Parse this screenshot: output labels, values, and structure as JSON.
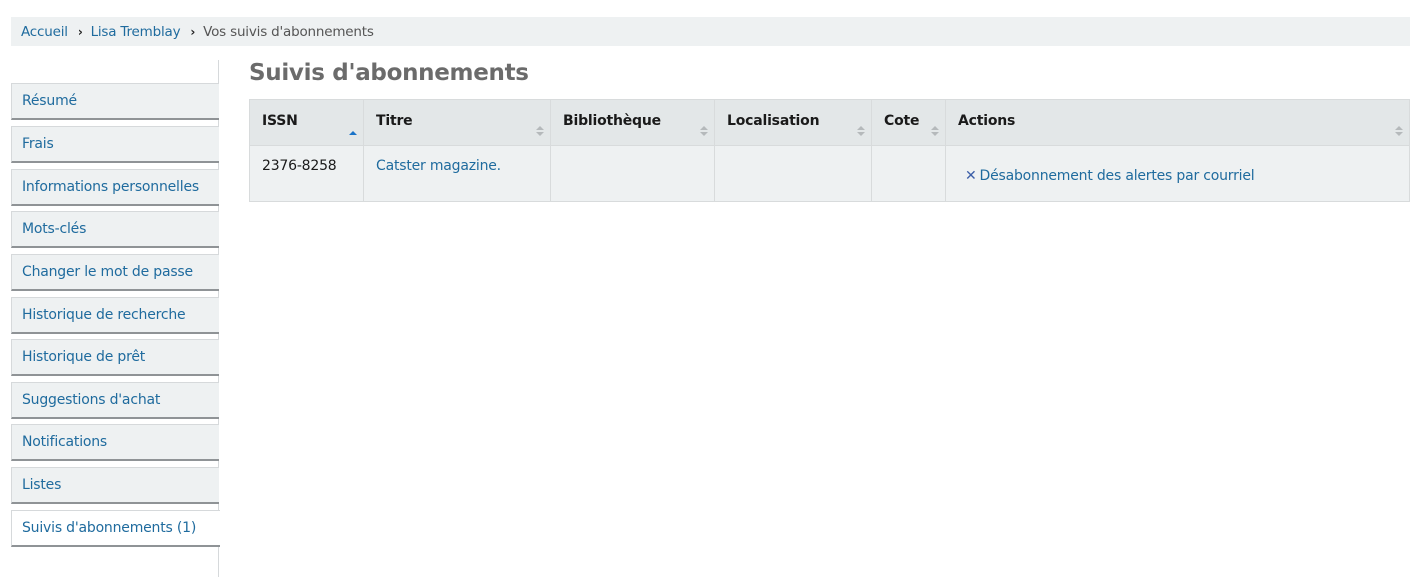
{
  "breadcrumb": {
    "items": [
      {
        "label": "Accueil",
        "link": true
      },
      {
        "label": "Lisa Tremblay",
        "link": true
      },
      {
        "label": "Vos suivis d'abonnements",
        "link": false
      }
    ],
    "separator_icon": "chevron-right-icon"
  },
  "sidebar": {
    "items": [
      {
        "label": "Résumé",
        "active": false
      },
      {
        "label": "Frais",
        "active": false
      },
      {
        "label": "Informations personnelles",
        "active": false
      },
      {
        "label": "Mots-clés",
        "active": false
      },
      {
        "label": "Changer le mot de passe",
        "active": false
      },
      {
        "label": "Historique de recherche",
        "active": false
      },
      {
        "label": "Historique de prêt",
        "active": false
      },
      {
        "label": "Suggestions d'achat",
        "active": false
      },
      {
        "label": "Notifications",
        "active": false
      },
      {
        "label": "Listes",
        "active": false
      },
      {
        "label": "Suivis d'abonnements (1)",
        "active": true
      }
    ]
  },
  "main": {
    "title": "Suivis d'abonnements",
    "table": {
      "columns": [
        {
          "label": "ISSN",
          "sort": "ascending"
        },
        {
          "label": "Titre",
          "sort": "none"
        },
        {
          "label": "Bibliothèque",
          "sort": "none"
        },
        {
          "label": "Localisation",
          "sort": "none"
        },
        {
          "label": "Cote",
          "sort": "none"
        },
        {
          "label": "Actions",
          "sort": "none"
        }
      ],
      "rows": [
        {
          "issn": "2376-8258",
          "title": "Catster magazine.",
          "library": "",
          "location": "",
          "callnumber": "",
          "action_label": "Désabonnement des alertes par courriel",
          "action_icon": "close-icon"
        }
      ]
    },
    "colors": {
      "link": "#1f6b9e",
      "sort_active": "#1a73c8",
      "sort_inactive": "#b5b9bb",
      "title": "#6b6b6b"
    }
  }
}
